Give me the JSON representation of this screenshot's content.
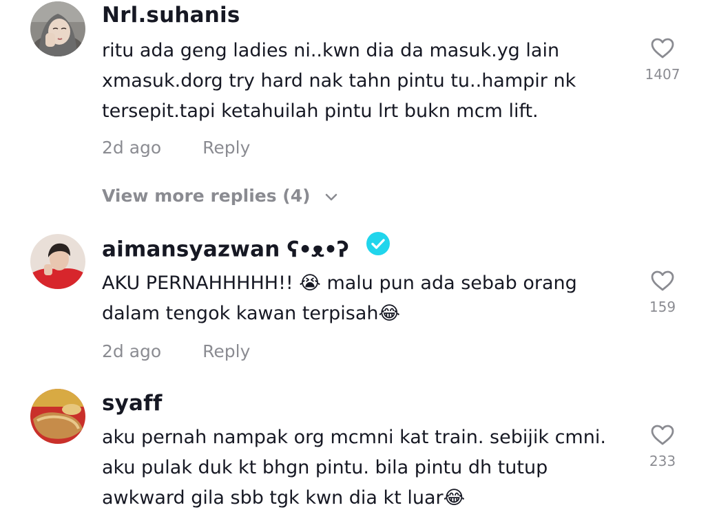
{
  "comments": [
    {
      "username": "Nrl.suhanis",
      "text": "ritu ada geng ladies ni..kwn dia da masuk.yg lain xmasuk.dorg try hard nak tahn pintu tu..hampir nk tersepit.tapi ketahuilah pintu lrt bukn mcm lift.",
      "time": "2d ago",
      "reply_label": "Reply",
      "likes": "1407",
      "avatar": "avatar-girl-hijab"
    },
    {
      "username": "aimansyazwan",
      "username_emoji": "ʕ•ᴥ•ʔ",
      "verified": true,
      "text": "AKU PERNAHHHHH!! 😭 malu pun ada sebab orang dalam tengok kawan terpisah😂",
      "time": "2d ago",
      "reply_label": "Reply",
      "likes": "159",
      "avatar": "avatar-man-red-jacket"
    },
    {
      "username": "syaff",
      "text": "aku pernah nampak org mcmni kat train. sebijik cmni. aku pulak duk kt bhgn pintu. bila pintu dh tutup awkward gila sbb tgk kwn dia kt luar😂",
      "time": "",
      "reply_label": "",
      "likes": "233",
      "avatar": "avatar-food"
    }
  ],
  "view_more": "View more replies (4)",
  "colors": {
    "primary_text": "#161823",
    "secondary_text": "rgba(22,24,35,0.5)",
    "verified": "#20D5EC",
    "background": "#ffffff"
  },
  "icons": [
    "heart-outline-icon",
    "chevron-down-icon",
    "verified-badge-icon"
  ]
}
